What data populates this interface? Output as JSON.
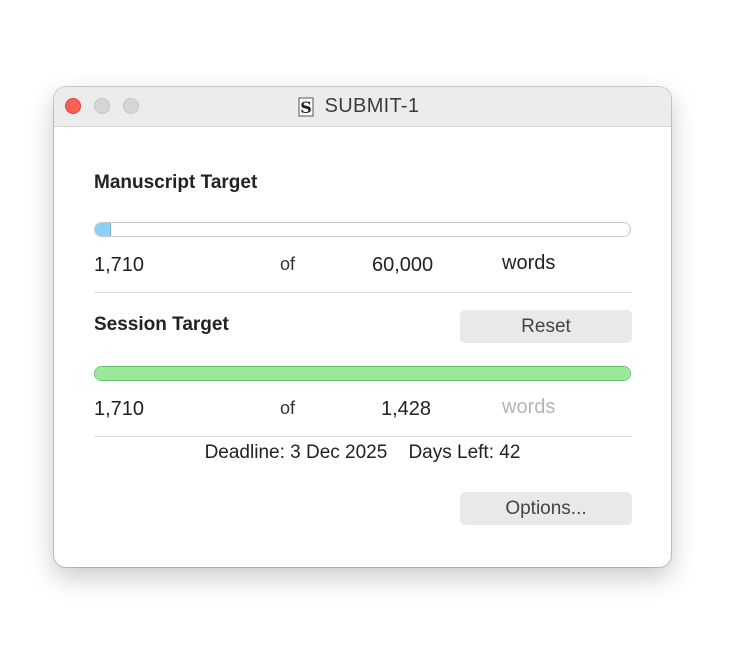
{
  "window": {
    "title": "SUBMIT-1",
    "title_icon": "scrivener-document-icon"
  },
  "manuscript": {
    "heading": "Manuscript Target",
    "current": "1,710",
    "of_label": "of",
    "target": "60,000",
    "unit": "words",
    "progress_fraction": 0.0285,
    "bar_color": "#8ecff6"
  },
  "session": {
    "heading": "Session Target",
    "reset_label": "Reset",
    "current": "1,710",
    "of_label": "of",
    "target": "1,428",
    "unit": "words",
    "progress_fraction": 1.0,
    "bar_color": "#9ce89a"
  },
  "footer": {
    "deadline_label": "Deadline:",
    "deadline_value": "3 Dec 2025",
    "days_left_label": "Days Left:",
    "days_left_value": "42",
    "options_label": "Options..."
  }
}
